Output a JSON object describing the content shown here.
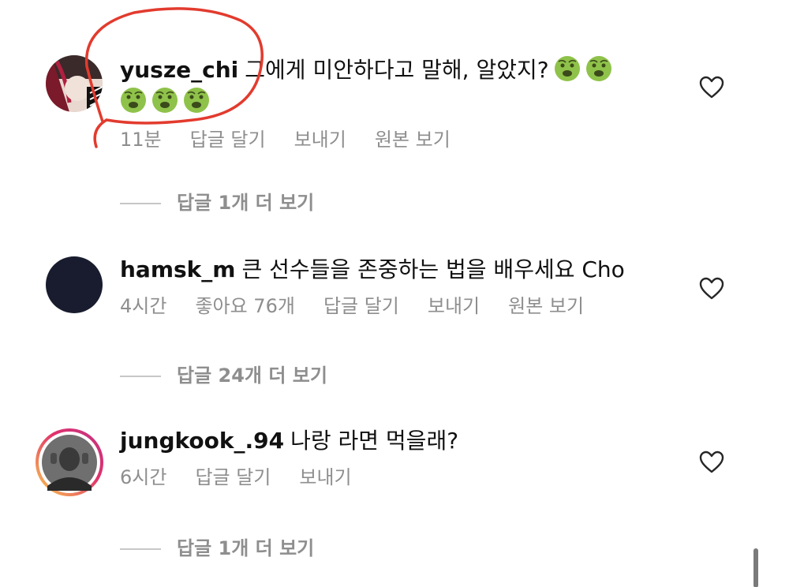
{
  "comments": [
    {
      "username": "yusze_chi",
      "text": "그에게 미안하다고 말해, 알았지?",
      "time": "11분",
      "reply": "답글 달기",
      "send": "보내기",
      "original": "원본 보기",
      "view_replies": "답글 1개 더 보기",
      "emoji": "nauseated-face"
    },
    {
      "username": "hamsk_m",
      "text": "큰 선수들을 존중하는 법을 배우세요 Cho",
      "time": "4시간",
      "likes": "좋아요 76개",
      "reply": "답글 달기",
      "send": "보내기",
      "original": "원본 보기",
      "view_replies": "답글 24개 더 보기"
    },
    {
      "username": "jungkook_.94",
      "text": "나랑 라면 먹을래?",
      "time": "6시간",
      "reply": "답글 달기",
      "send": "보내기",
      "view_replies": "답글 1개 더 보기"
    }
  ],
  "colors": {
    "annotation": "#e23b2e",
    "meta_text": "#8e8e8e",
    "avatar_dark": "#181c2e",
    "emoji_green": "#8fc24a",
    "story_ring_start": "#f9c74f",
    "story_ring_end": "#c13584"
  }
}
